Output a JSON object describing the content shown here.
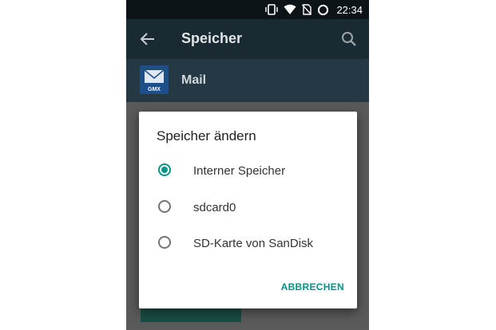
{
  "status_bar": {
    "time": "22:34",
    "icons": [
      "vibrate-icon",
      "wifi-icon",
      "no-sim-icon",
      "battery-saver-icon"
    ]
  },
  "toolbar": {
    "title": "Speicher",
    "back_icon": "back-arrow-icon",
    "search_icon": "search-icon"
  },
  "app": {
    "name": "Mail",
    "icon_label": "GMX"
  },
  "dialog": {
    "title": "Speicher ändern",
    "options": [
      {
        "label": "Interner Speicher",
        "checked": true
      },
      {
        "label": "sdcard0",
        "checked": false
      },
      {
        "label": "SD-Karte von SanDisk",
        "checked": false
      }
    ],
    "cancel_label": "ABBRECHEN"
  },
  "colors": {
    "accent": "#009688",
    "toolbar": "#1a2a33",
    "app_row": "#243944"
  }
}
